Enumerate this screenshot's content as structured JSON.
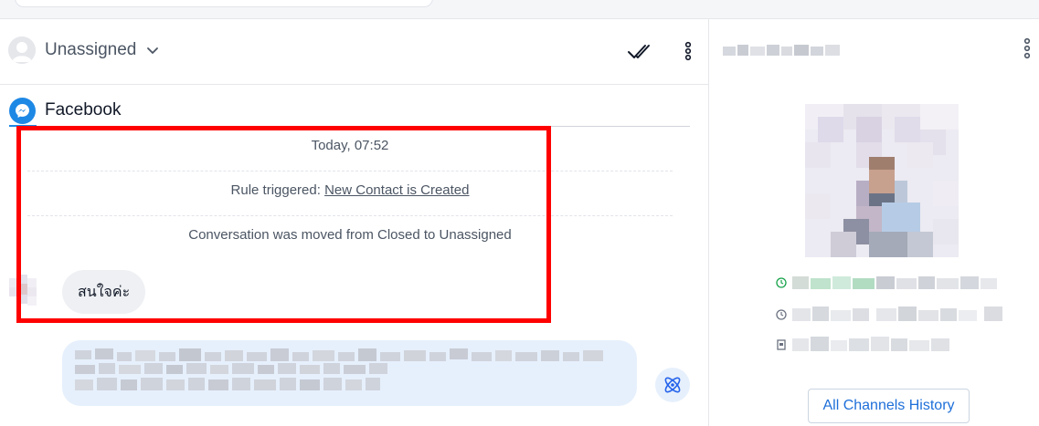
{
  "header": {
    "assignee_label": "Unassigned"
  },
  "channel": {
    "name": "Facebook"
  },
  "activity": {
    "timestamp": "Today, 07:52",
    "rule_prefix": "Rule triggered: ",
    "rule_name": "New Contact is Created",
    "status_change": "Conversation was moved from Closed to Unassigned"
  },
  "messages": [
    {
      "direction": "incoming",
      "text": "สนใจค่ะ"
    }
  ],
  "contact_panel": {
    "history_button": "All Channels History"
  },
  "colors": {
    "accent": "#1e88e5",
    "highlight": "#ff0000",
    "composer_bg": "#e6f0fc",
    "link": "#1e6fd9"
  },
  "icons": [
    "avatar-icon",
    "chevron-down-icon",
    "check-double-icon",
    "more-vertical-icon",
    "messenger-icon",
    "ai-assist-icon",
    "clock-icon",
    "phone-icon"
  ]
}
